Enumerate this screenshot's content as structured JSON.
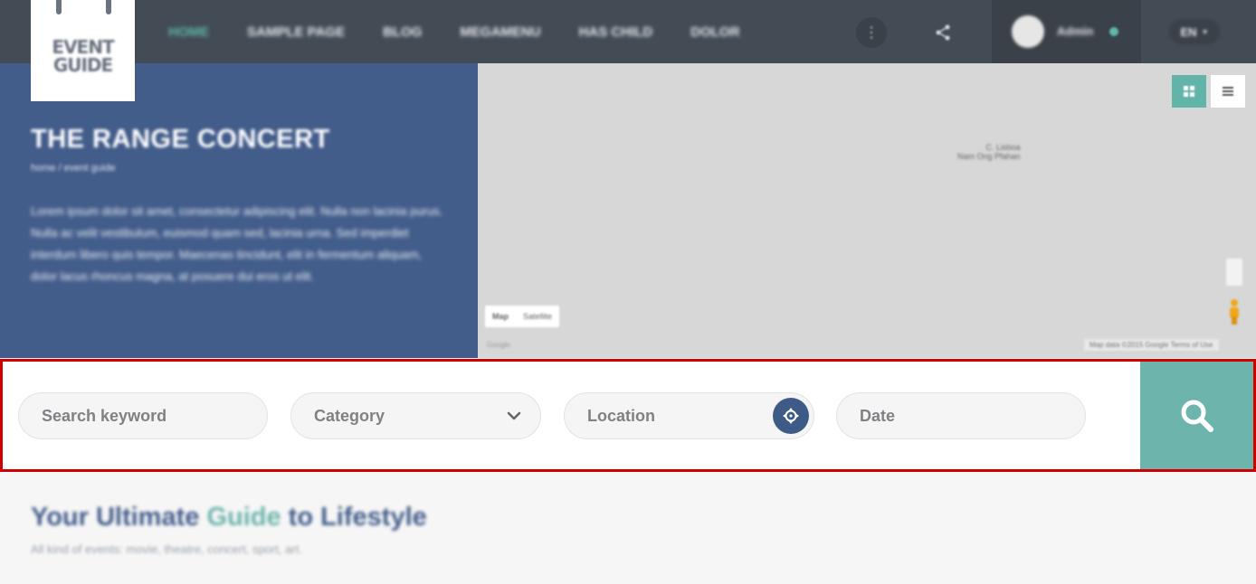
{
  "header": {
    "logo_line1": "EVENT",
    "logo_line2": "GUIDE",
    "nav": [
      "HOME",
      "SAMPLE PAGE",
      "BLOG",
      "MEGAMENU",
      "HAS CHILD",
      "DOLOR"
    ],
    "active_nav": "HOME",
    "user_name": "Admin",
    "language": "EN"
  },
  "hero": {
    "title": "THE RANGE CONCERT",
    "breadcrumb": "home / event guide",
    "description": "Lorem ipsum dolor sit amet, consectetur adipiscing elit. Nulla non lacinia purus. Nulla ac velit vestibulum, euismod quam sed, lacinia urna. Sed imperdiet interdum libero quis tempor. Maecenas tincidunt, elit in fermentum aliquam, dolor lacus rhoncus magna, at posuere dui eros ut elit."
  },
  "map": {
    "label_line1": "C. Lisboa",
    "label_line2": "Nam Ong Pfahan",
    "type_map": "Map",
    "type_satellite": "Satellite",
    "terms": "Map data ©2015 Google  Terms of Use",
    "google": "Google"
  },
  "search": {
    "keyword_placeholder": "Search keyword",
    "category_label": "Category",
    "location_placeholder": "Location",
    "date_placeholder": "Date"
  },
  "tagline": {
    "part1": "Your Ultimate ",
    "accent": "Guide",
    "part2": " to Lifestyle",
    "subtitle": "All kind of events: movie, theatre, concert, sport, art."
  },
  "colors": {
    "nav_bg": "#434b55",
    "hero_blue": "#435d8b",
    "teal": "#6db4ad",
    "highlight": "#d10000"
  }
}
